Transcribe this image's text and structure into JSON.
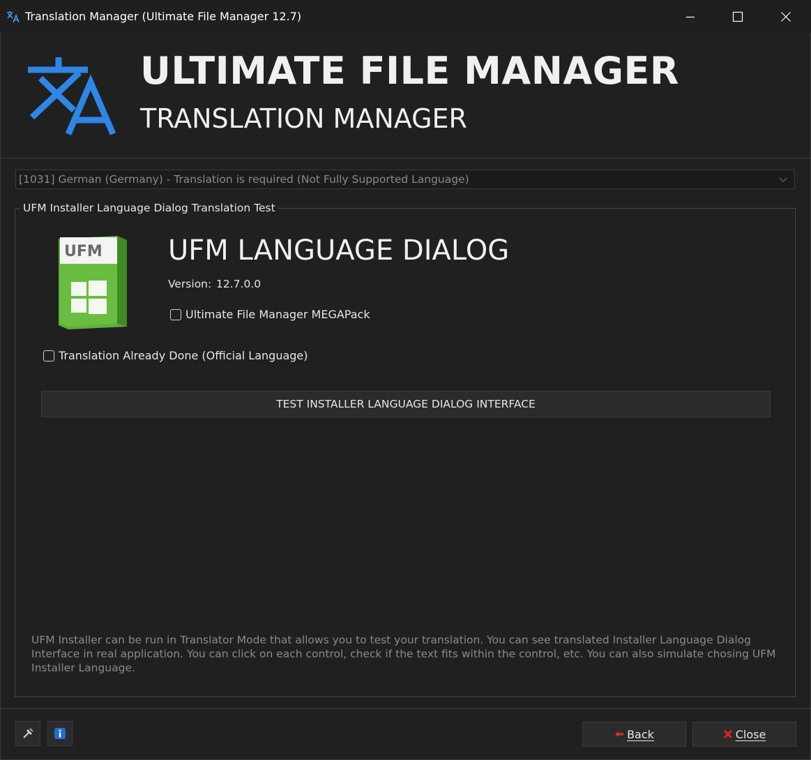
{
  "window": {
    "title": "Translation Manager (Ultimate File Manager 12.7)",
    "icon": "translate-icon"
  },
  "header": {
    "app_name": "ULTIMATE FILE MANAGER",
    "subtitle": "TRANSLATION MANAGER",
    "logo_icon": "translate-icon",
    "accent_color": "#2e86e6"
  },
  "language_select": {
    "value": "[1031] German (Germany) - Translation is required (Not Fully Supported Language)"
  },
  "group": {
    "title": "UFM Installer Language Dialog Translation Test",
    "product_box_label": "UFM",
    "dialog_title": "UFM LANGUAGE DIALOG",
    "version_label": "Version:",
    "version_value": "12.7.0.0",
    "megapack_label": "Ultimate File Manager MEGAPack",
    "megapack_checked": false,
    "translation_done_label": "Translation Already Done (Official Language)",
    "translation_done_checked": false,
    "test_button_label": "TEST INSTALLER LANGUAGE DIALOG INTERFACE",
    "info_text": "UFM Installer can be run in Translator Mode that allows you to test your translation. You can see translated Installer Language Dialog Interface in real application. You can click on each control, check if the text fits within the control, etc. You can also simulate chosing UFM Installer Language."
  },
  "footer": {
    "back_label": "Back",
    "close_label": "Close",
    "tools_icon": "tools-icon",
    "info_icon": "info-icon"
  }
}
